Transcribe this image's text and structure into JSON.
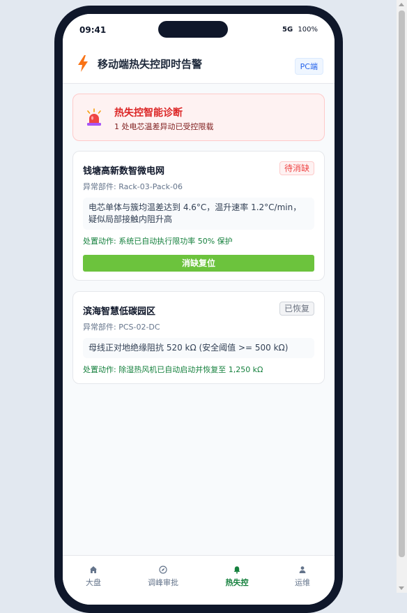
{
  "status_bar": {
    "time": "09:41",
    "network": "5G",
    "battery": "100%"
  },
  "header": {
    "icon": "bolt-icon",
    "title": "移动端热失控即时告警",
    "pc_button": "PC端"
  },
  "diagnosis": {
    "icon": "siren-icon",
    "title": "热失控智能诊断",
    "subtitle": "1 处电芯温差异动已受控限载"
  },
  "alerts": [
    {
      "site": "钱塘高新数智微电网",
      "status": "待消缺",
      "part": "异常部件: Rack-03-Pack-06",
      "message": "电芯单体与簇均温差达到 4.6°C，温升速率 1.2°C/min，疑似局部接触内阻升高",
      "action": "处置动作: 系统已自动执行限功率 50% 保护",
      "button": "消缺复位"
    },
    {
      "site": "滨海智慧低碳园区",
      "status": "已恢复",
      "part": "异常部件: PCS-02-DC",
      "message": "母线正对地绝缘阻抗 520 kΩ (安全阈值 >= 500 kΩ)",
      "action": "处置动作: 除湿热风机已自动启动并恢复至 1,250 kΩ"
    }
  ],
  "nav": {
    "items": [
      {
        "label": "大盘",
        "icon": "home-icon"
      },
      {
        "label": "调峰审批",
        "icon": "compass-icon"
      },
      {
        "label": "热失控",
        "icon": "bell-icon",
        "active": true
      },
      {
        "label": "运维",
        "icon": "user-icon"
      }
    ]
  },
  "colors": {
    "accent": "#15803d",
    "alert_red": "#dc2626",
    "button_green": "#6cc33d"
  }
}
